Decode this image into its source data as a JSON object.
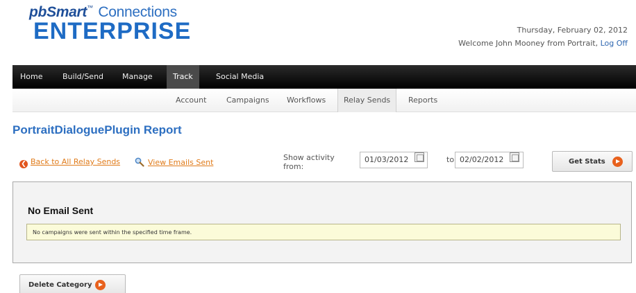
{
  "logo": {
    "brand_prefix": "pb",
    "brand_name": "Smart",
    "trademark": "™",
    "connections": "Connections",
    "product": "ENTERPRISE"
  },
  "header": {
    "date": "Thursday, February 02, 2012",
    "welcome": "Welcome John Mooney from Portrait,",
    "logoff": "Log Off"
  },
  "main_nav": {
    "items": [
      {
        "label": "Home"
      },
      {
        "label": "Build/Send"
      },
      {
        "label": "Manage"
      },
      {
        "label": "Track",
        "active": true
      },
      {
        "label": "Social Media"
      }
    ]
  },
  "sub_nav": {
    "items": [
      {
        "label": "Account"
      },
      {
        "label": "Campaigns"
      },
      {
        "label": "Workflows"
      },
      {
        "label": "Relay Sends",
        "active": true
      },
      {
        "label": "Reports"
      }
    ]
  },
  "page": {
    "title": "PortraitDialoguePlugin Report"
  },
  "actions": {
    "back_link": "Back to All Relay Sends",
    "view_link": "View Emails Sent"
  },
  "filter": {
    "show_label": "Show activity from:",
    "from_date": "01/03/2012",
    "to_label": "to:",
    "to_date": "02/02/2012",
    "get_stats": "Get Stats"
  },
  "results": {
    "heading": "No Email Sent",
    "notice": "No campaigns were sent within the specified time frame."
  },
  "footer": {
    "delete_category": "Delete Category"
  },
  "colors": {
    "brand_blue": "#1e6bc4",
    "link_orange": "#e07b1a",
    "nav_black": "#111111",
    "notice_bg": "#fbfbd9"
  }
}
